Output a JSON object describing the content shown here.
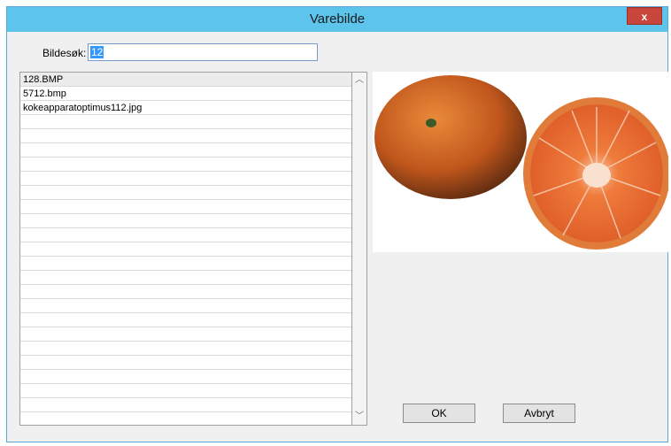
{
  "window": {
    "title": "Varebilde",
    "close_label": "x"
  },
  "search": {
    "label": "Bildesøk:",
    "value": "12"
  },
  "files": {
    "items": [
      "128.BMP",
      "5712.bmp",
      "kokeapparatoptimus112.jpg"
    ],
    "empty_rows": 21
  },
  "scrollbar": {
    "up_arrow": "︿",
    "down_arrow": "﹀"
  },
  "preview": {
    "description_icon": "orange-image-preview"
  },
  "buttons": {
    "ok_label": "OK",
    "cancel_label": "Avbryt"
  },
  "colors": {
    "titlebar": "#5dc4ec",
    "selection": "#3399ff",
    "close": "#c9463d"
  }
}
